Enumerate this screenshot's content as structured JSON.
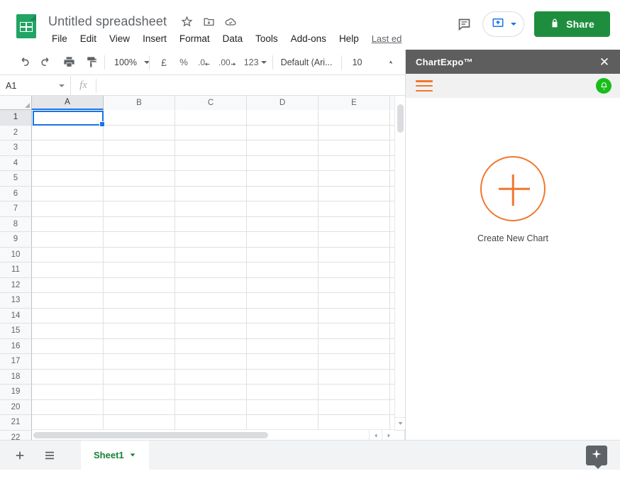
{
  "app": {
    "logo_icon": "sheets-document-icon",
    "doc_title": "Untitled spreadsheet",
    "title_icons": [
      {
        "name": "star-icon",
        "glyph": "☆"
      },
      {
        "name": "move-to-folder-icon",
        "glyph": "▣"
      },
      {
        "name": "cloud-saved-icon",
        "glyph": "☁"
      }
    ],
    "menus": [
      "File",
      "Edit",
      "View",
      "Insert",
      "Format",
      "Data",
      "Tools",
      "Add-ons",
      "Help"
    ],
    "last_edit": "Last ed",
    "comment_icon": "comment-icon",
    "present_icon": "present-upload-icon",
    "share_label": "Share",
    "share_lock_icon": "lock-icon",
    "share_color": "#1e8e3e"
  },
  "toolbar": {
    "undo_icon": "undo-icon",
    "redo_icon": "redo-icon",
    "print_icon": "print-icon",
    "paint_icon": "paint-format-icon",
    "zoom_value": "100%",
    "currency_label": "£",
    "percent_label": "%",
    "decimal_decrease_label": ".0",
    "decimal_increase_label": ".00",
    "number_format_label": "123",
    "font_name": "Default (Ari...",
    "font_size": "10"
  },
  "formula_bar": {
    "name_box_value": "A1",
    "fx_label": "fx",
    "formula_value": ""
  },
  "grid": {
    "columns": [
      "A",
      "B",
      "C",
      "D",
      "E"
    ],
    "selected_column": "A",
    "rows": [
      1,
      2,
      3,
      4,
      5,
      6,
      7,
      8,
      9,
      10,
      11,
      12,
      13,
      14,
      15,
      16,
      17,
      18,
      19,
      20,
      21,
      22
    ],
    "selected_row": 1,
    "active_cell": "A1",
    "selection_color": "#1a73e8"
  },
  "bottom": {
    "add_sheet_icon": "add-sheet-icon",
    "all_sheets_icon": "all-sheets-icon",
    "sheets": [
      {
        "name": "Sheet1",
        "active": true
      }
    ],
    "explore_icon": "explore-star-icon"
  },
  "panel": {
    "title": "ChartExpo™",
    "close_icon": "close-icon",
    "menu_icon": "hamburger-menu-icon",
    "notification_icon": "notification-bell-icon",
    "create_icon": "plus-circle-icon",
    "create_label": "Create New Chart",
    "accent_color": "#f2762e",
    "header_color": "#5e5e5e",
    "bell_color": "#19bd19"
  }
}
